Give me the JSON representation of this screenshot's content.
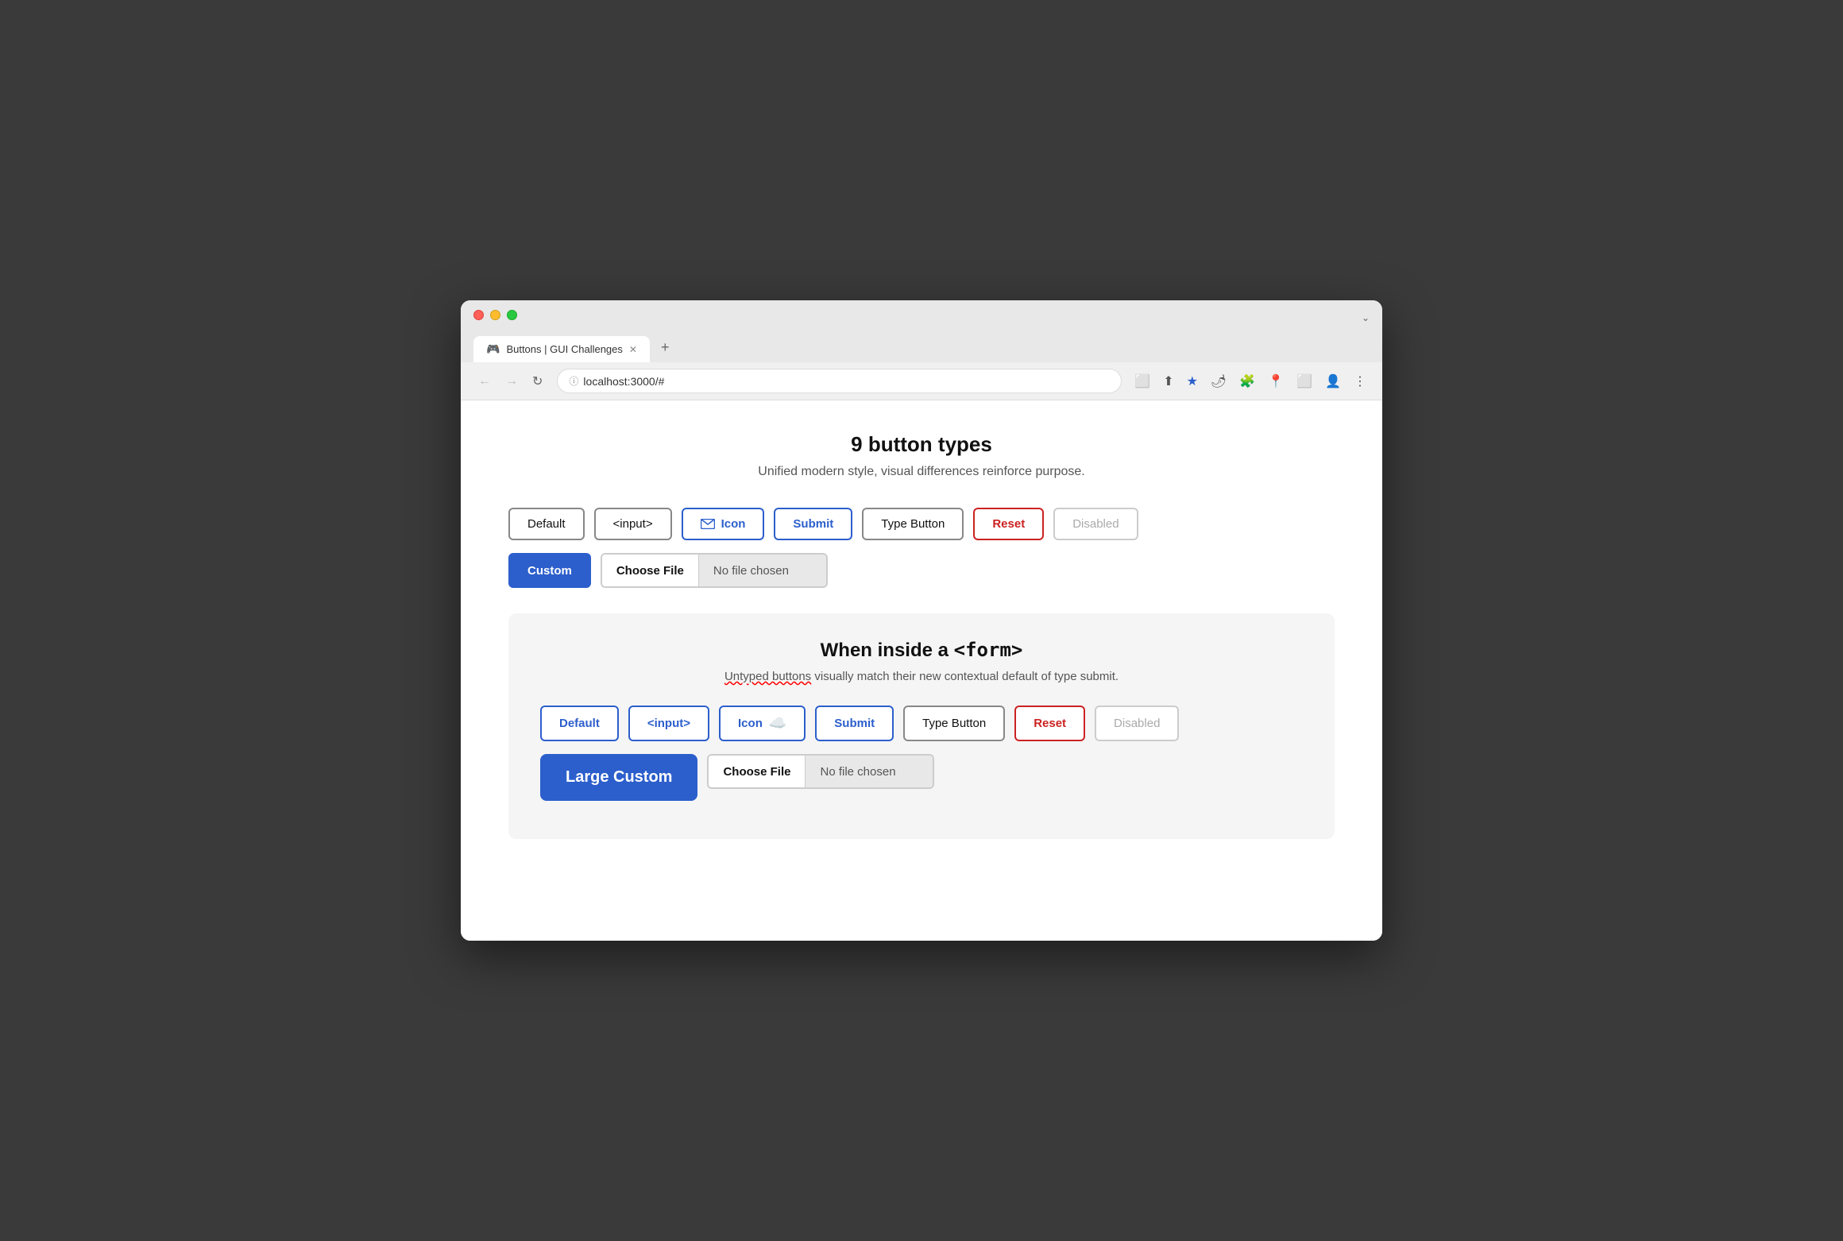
{
  "browser": {
    "traffic_lights": [
      "red",
      "yellow",
      "green"
    ],
    "tab_icon": "🎮",
    "tab_title": "Buttons | GUI Challenges",
    "tab_close": "✕",
    "new_tab": "+",
    "chevron": "⌄",
    "nav_back": "←",
    "nav_forward": "→",
    "nav_refresh": "↻",
    "url_lock": "ⓘ",
    "url": "localhost:3000/#",
    "toolbar_icons": [
      "⬜",
      "⬆",
      "★",
      "🌶",
      "🧩",
      "📍",
      "⬜",
      "👤",
      "⋮"
    ]
  },
  "page": {
    "section1": {
      "title": "9 button types",
      "subtitle": "Unified modern style, visual differences reinforce purpose."
    },
    "buttons_row1": [
      {
        "label": "Default",
        "type": "default"
      },
      {
        "label": "<input>",
        "type": "input"
      },
      {
        "label": "Icon",
        "type": "icon"
      },
      {
        "label": "Submit",
        "type": "submit"
      },
      {
        "label": "Type Button",
        "type": "type-button"
      },
      {
        "label": "Reset",
        "type": "reset"
      },
      {
        "label": "Disabled",
        "type": "disabled"
      }
    ],
    "buttons_row2": [
      {
        "label": "Custom",
        "type": "custom"
      },
      {
        "label": "Choose File",
        "type": "file"
      },
      {
        "label": "No file chosen",
        "type": "file-status"
      }
    ],
    "section2": {
      "title": "When inside a ",
      "title_code": "<form>",
      "subtitle_before": "Untyped buttons",
      "subtitle_after": " visually match their new contextual default of type submit."
    },
    "form_buttons_row1": [
      {
        "label": "Default",
        "type": "default-form"
      },
      {
        "label": "<input>",
        "type": "input-form"
      },
      {
        "label": "Icon",
        "type": "icon-form"
      },
      {
        "label": "Submit",
        "type": "submit-form"
      },
      {
        "label": "Type Button",
        "type": "type-button-form"
      },
      {
        "label": "Reset",
        "type": "reset-form"
      },
      {
        "label": "Disabled",
        "type": "disabled-form"
      }
    ],
    "form_buttons_row2": [
      {
        "label": "Large Custom",
        "type": "large-custom"
      },
      {
        "label": "Choose File",
        "type": "file-form"
      },
      {
        "label": "No file chosen",
        "type": "file-status-form"
      }
    ]
  }
}
